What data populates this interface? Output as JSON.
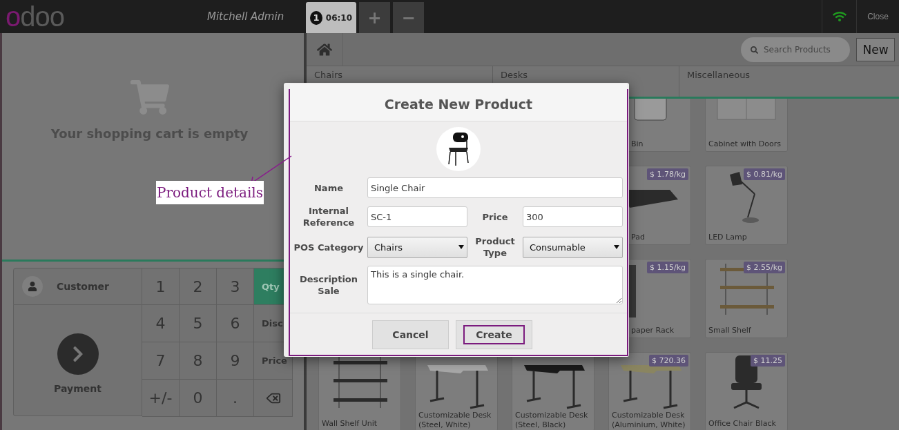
{
  "header": {
    "logo": "odoo",
    "user": "Mitchell Admin",
    "orders": [
      {
        "number": "1",
        "time": "06:10",
        "selected": true
      }
    ],
    "order_buttons": [
      "+",
      "−"
    ],
    "close": "Close"
  },
  "cart": {
    "empty_message": "Your shopping cart is empty"
  },
  "pad": {
    "customer": "Customer",
    "payment": "Payment",
    "keys": [
      {
        "kind": "digit",
        "label": "1"
      },
      {
        "kind": "digit",
        "label": "2"
      },
      {
        "kind": "digit",
        "label": "3"
      },
      {
        "kind": "mode",
        "label": "Qty",
        "selected": true
      },
      {
        "kind": "digit",
        "label": "4"
      },
      {
        "kind": "digit",
        "label": "5"
      },
      {
        "kind": "digit",
        "label": "6"
      },
      {
        "kind": "mode",
        "label": "Disc",
        "selected": false
      },
      {
        "kind": "digit",
        "label": "7"
      },
      {
        "kind": "digit",
        "label": "8"
      },
      {
        "kind": "digit",
        "label": "9"
      },
      {
        "kind": "mode",
        "label": "Price",
        "selected": false
      },
      {
        "kind": "digit",
        "label": "+/-"
      },
      {
        "kind": "digit",
        "label": "0"
      },
      {
        "kind": "digit",
        "label": "."
      },
      {
        "kind": "backspace"
      }
    ]
  },
  "products": {
    "search": {
      "placeholder": "Search Products"
    },
    "new_button": "New",
    "categories": [
      "Chairs",
      "Desks",
      "Miscellaneous"
    ],
    "items": [
      {
        "kind": "bin",
        "name": "Bin",
        "cut": true
      },
      {
        "kind": "cabinet",
        "name": "Cabinet with Doors",
        "cut": false
      },
      {
        "kind": "mat",
        "name": "Pad",
        "price": "$ 1.78/kg",
        "cut": true
      },
      {
        "kind": "lamp",
        "name": "LED Lamp",
        "price": "$ 0.81/kg",
        "cut": false
      },
      {
        "kind": "rack",
        "name": "paper Rack",
        "price": "$ 1.15/kg",
        "cut": true
      },
      {
        "kind": "shelf",
        "name": "Small Shelf",
        "price": "$ 2.55/kg",
        "cut": false
      }
    ],
    "bottom_row": [
      {
        "kind": "wall-shelf",
        "name": "Wall Shelf Unit"
      },
      {
        "kind": "desk-light",
        "name": "Customizable Desk (Steel, White)"
      },
      {
        "kind": "desk-dark",
        "name": "Customizable Desk (Steel, Black)"
      },
      {
        "kind": "desk-oak",
        "name": "Customizable Desk (Aluminium, White)",
        "price": "$ 720.36"
      },
      {
        "kind": "chair",
        "name": "Office Chair Black",
        "price": "$ 11.25"
      }
    ]
  },
  "dialog": {
    "title": "Create New Product",
    "name": {
      "label": "Name",
      "value": "Single Chair"
    },
    "reference": {
      "label": "Internal Reference",
      "value": "SC-1"
    },
    "price": {
      "label": "Price",
      "value": "300"
    },
    "category": {
      "label": "POS Category",
      "value": "Chairs"
    },
    "type": {
      "label": "Product Type",
      "value": "Consumable"
    },
    "description": {
      "label": "Description Sale",
      "value": "This is a single chair."
    },
    "buttons": [
      {
        "label": "Cancel",
        "highlighted": false
      },
      {
        "label": "Create",
        "highlighted": true
      }
    ]
  },
  "annotation": {
    "text": "Product details"
  }
}
